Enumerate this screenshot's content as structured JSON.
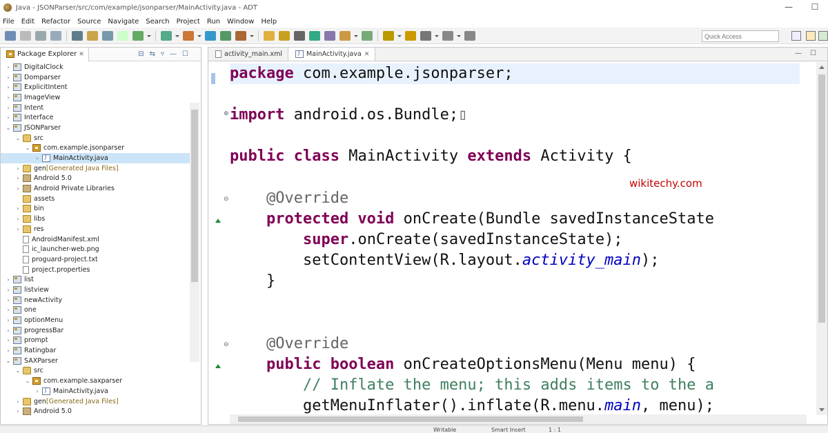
{
  "window": {
    "title": "Java - JSONParser/src/com/example/jsonparser/MainActivity.java - ADT",
    "min": "—",
    "max": "☐"
  },
  "menu": [
    "File",
    "Edit",
    "Refactor",
    "Source",
    "Navigate",
    "Search",
    "Project",
    "Run",
    "Window",
    "Help"
  ],
  "quick_access": {
    "placeholder": "Quick Access"
  },
  "package_explorer": {
    "title": "Package Explorer",
    "tree": [
      {
        "level": 0,
        "twisty": ">",
        "icon": "proj",
        "label": "DigitalClock"
      },
      {
        "level": 0,
        "twisty": ">",
        "icon": "proj",
        "label": "Domparser"
      },
      {
        "level": 0,
        "twisty": ">",
        "icon": "proj",
        "label": "ExplicitIntent"
      },
      {
        "level": 0,
        "twisty": ">",
        "icon": "proj",
        "label": "ImageView"
      },
      {
        "level": 0,
        "twisty": ">",
        "icon": "proj",
        "label": "Intent"
      },
      {
        "level": 0,
        "twisty": ">",
        "icon": "proj",
        "label": "Interface"
      },
      {
        "level": 0,
        "twisty": "v",
        "icon": "proj",
        "label": "JSONParser"
      },
      {
        "level": 1,
        "twisty": "v",
        "icon": "src",
        "label": "src"
      },
      {
        "level": 2,
        "twisty": "v",
        "icon": "pkgi",
        "label": "com.example.jsonparser"
      },
      {
        "level": 3,
        "twisty": ">",
        "icon": "java",
        "label": "MainActivity.java",
        "selected": true
      },
      {
        "level": 1,
        "twisty": ">",
        "icon": "src",
        "label": "gen",
        "suffix": "[Generated Java Files]"
      },
      {
        "level": 1,
        "twisty": ">",
        "icon": "lib",
        "label": "Android 5.0"
      },
      {
        "level": 1,
        "twisty": ">",
        "icon": "lib",
        "label": "Android Private Libraries"
      },
      {
        "level": 1,
        "twisty": "",
        "icon": "folder",
        "label": "assets"
      },
      {
        "level": 1,
        "twisty": ">",
        "icon": "folder",
        "label": "bin"
      },
      {
        "level": 1,
        "twisty": ">",
        "icon": "folder",
        "label": "libs"
      },
      {
        "level": 1,
        "twisty": ">",
        "icon": "folder",
        "label": "res"
      },
      {
        "level": 1,
        "twisty": "",
        "icon": "file",
        "label": "AndroidManifest.xml"
      },
      {
        "level": 1,
        "twisty": "",
        "icon": "file",
        "label": "ic_launcher-web.png"
      },
      {
        "level": 1,
        "twisty": "",
        "icon": "file",
        "label": "proguard-project.txt"
      },
      {
        "level": 1,
        "twisty": "",
        "icon": "file",
        "label": "project.properties"
      },
      {
        "level": 0,
        "twisty": ">",
        "icon": "proj",
        "label": "list"
      },
      {
        "level": 0,
        "twisty": ">",
        "icon": "proj",
        "label": "listview"
      },
      {
        "level": 0,
        "twisty": ">",
        "icon": "proj",
        "label": "newActivity"
      },
      {
        "level": 0,
        "twisty": ">",
        "icon": "proj",
        "label": "one"
      },
      {
        "level": 0,
        "twisty": ">",
        "icon": "proj",
        "label": "optionMenu"
      },
      {
        "level": 0,
        "twisty": ">",
        "icon": "proj",
        "label": "progressBar"
      },
      {
        "level": 0,
        "twisty": ">",
        "icon": "proj",
        "label": "prompt"
      },
      {
        "level": 0,
        "twisty": ">",
        "icon": "proj",
        "label": "Ratingbar"
      },
      {
        "level": 0,
        "twisty": "v",
        "icon": "proj",
        "label": "SAXParser"
      },
      {
        "level": 1,
        "twisty": "v",
        "icon": "src",
        "label": "src"
      },
      {
        "level": 2,
        "twisty": "v",
        "icon": "pkgi",
        "label": "com.example.saxparser"
      },
      {
        "level": 3,
        "twisty": ">",
        "icon": "java",
        "label": "MainActivity.java"
      },
      {
        "level": 1,
        "twisty": ">",
        "icon": "src",
        "label": "gen",
        "suffix": "[Generated Java Files]"
      },
      {
        "level": 1,
        "twisty": ">",
        "icon": "lib",
        "label": "Android 5.0"
      }
    ]
  },
  "editor": {
    "tabs": [
      {
        "label": "activity_main.xml",
        "active": false
      },
      {
        "label": "MainActivity.java",
        "active": true
      }
    ],
    "watermark": "wikitechy.com",
    "lines": [
      [
        {
          "t": "package",
          "c": "kw"
        },
        {
          "t": " com.example.jsonparser;",
          "c": ""
        }
      ],
      [
        {
          "t": "import",
          "c": "kw"
        },
        {
          "t": " android.os.Bundle;",
          "c": ""
        },
        {
          "t": "▯",
          "c": "ann"
        }
      ],
      [
        {
          "t": "public class",
          "c": "kw"
        },
        {
          "t": " MainActivity ",
          "c": ""
        },
        {
          "t": "extends",
          "c": "kw"
        },
        {
          "t": " Activity {",
          "c": ""
        }
      ],
      [
        {
          "t": "    @Override",
          "c": "ann"
        }
      ],
      [
        {
          "t": "    ",
          "c": ""
        },
        {
          "t": "protected void",
          "c": "kw"
        },
        {
          "t": " onCreate(Bundle savedInstanceState",
          "c": ""
        }
      ],
      [
        {
          "t": "        ",
          "c": ""
        },
        {
          "t": "super",
          "c": "kw"
        },
        {
          "t": ".onCreate(savedInstanceState);",
          "c": ""
        }
      ],
      [
        {
          "t": "        setContentView(R.layout.",
          "c": ""
        },
        {
          "t": "activity_main",
          "c": "fld"
        },
        {
          "t": ");",
          "c": ""
        }
      ],
      [
        {
          "t": "    }",
          "c": ""
        }
      ],
      [
        {
          "t": "    @Override",
          "c": "ann"
        }
      ],
      [
        {
          "t": "    ",
          "c": ""
        },
        {
          "t": "public boolean",
          "c": "kw"
        },
        {
          "t": " onCreateOptionsMenu(Menu menu) {",
          "c": ""
        }
      ],
      [
        {
          "t": "        ",
          "c": ""
        },
        {
          "t": "// Inflate the menu; this adds items to the a",
          "c": "cmt"
        }
      ],
      [
        {
          "t": "        getMenuInflater().inflate(R.menu.",
          "c": ""
        },
        {
          "t": "main",
          "c": "fld"
        },
        {
          "t": ", menu);",
          "c": ""
        }
      ]
    ]
  },
  "status": {
    "writable": "Writable",
    "insert": "Smart Insert",
    "position": "1 : 1"
  }
}
